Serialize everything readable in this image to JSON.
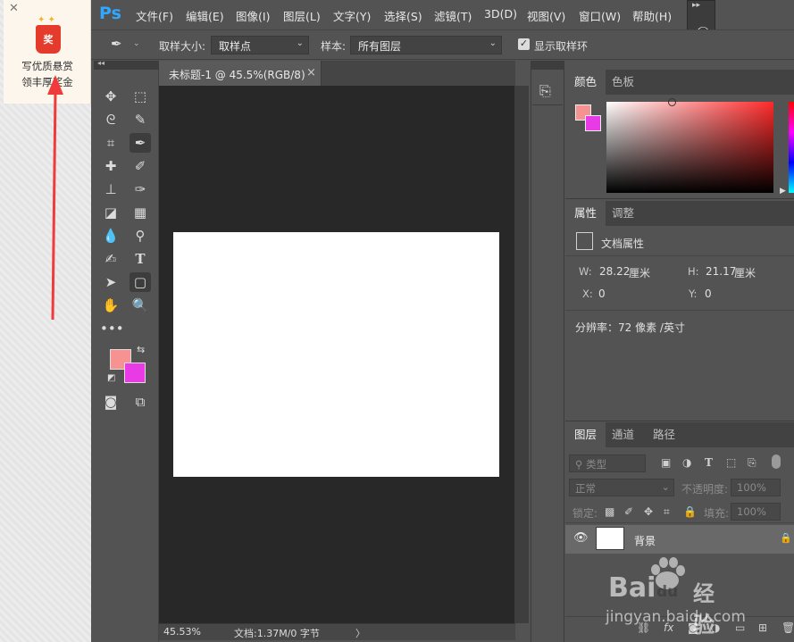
{
  "promo": {
    "close": "✕",
    "badge": "奖",
    "line1": "写优质悬赏",
    "line2": "领丰厚奖金"
  },
  "app": {
    "logo": "Ps",
    "menu": [
      "文件(F)",
      "编辑(E)",
      "图像(I)",
      "图层(L)",
      "文字(Y)",
      "选择(S)",
      "滤镜(T)",
      "3D(D)",
      "视图(V)",
      "窗口(W)",
      "帮助(H)"
    ]
  },
  "options": {
    "sample_size_label": "取样大小:",
    "sample_size_value": "取样点",
    "sample_label": "样本:",
    "sample_value": "所有图层",
    "show_ring_checked": true,
    "show_ring_label": "显示取样环"
  },
  "colors": {
    "foreground": "#f79293",
    "background": "#e83be6",
    "accent": "#31a8ff"
  },
  "document": {
    "tab_title": "未标题-1 @ 45.5%(RGB/8)",
    "close": "×",
    "zoom": "45.53%",
    "doc_info": "文档:1.37M/0 字节",
    "status_arrow": "〉"
  },
  "color_panel": {
    "tabs": [
      "颜色",
      "色板"
    ]
  },
  "properties_panel": {
    "tabs": [
      "属性",
      "调整"
    ],
    "header": "文档属性",
    "w_label": "W:",
    "w_value": "28.22",
    "w_unit": "厘米",
    "h_label": "H:",
    "h_value": "21.17",
    "h_unit": "厘米",
    "x_label": "X:",
    "x_value": "0",
    "y_label": "Y:",
    "y_value": "0",
    "resolution": "分辨率：72 像素 /英寸"
  },
  "layers_panel": {
    "tabs": [
      "图层",
      "通道",
      "路径"
    ],
    "filter_kind": "类型",
    "blend_mode": "正常",
    "opacity_label": "不透明度:",
    "opacity_value": "100%",
    "lock_label": "锁定:",
    "fill_label": "填充:",
    "fill_value": "100%",
    "layer_name": "背景"
  },
  "watermark": {
    "brand": "Bai",
    "brand2": "du",
    "brand_cn": "经验",
    "url": "jingyan.baidu.com"
  }
}
